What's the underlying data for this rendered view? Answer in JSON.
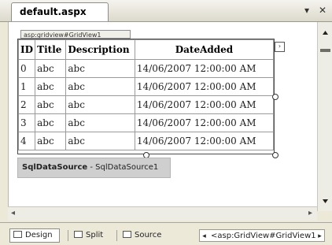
{
  "tab": {
    "title": "default.aspx",
    "dropdown_glyph": "▾",
    "close_glyph": "✕"
  },
  "control_tag": "asp:gridview#GridView1",
  "grid": {
    "columns": [
      "ID",
      "Title",
      "Description",
      "DateAdded"
    ],
    "rows": [
      [
        "0",
        "abc",
        "abc",
        "14/06/2007 12:00:00 AM"
      ],
      [
        "1",
        "abc",
        "abc",
        "14/06/2007 12:00:00 AM"
      ],
      [
        "2",
        "abc",
        "abc",
        "14/06/2007 12:00:00 AM"
      ],
      [
        "3",
        "abc",
        "abc",
        "14/06/2007 12:00:00 AM"
      ],
      [
        "4",
        "abc",
        "abc",
        "14/06/2007 12:00:00 AM"
      ]
    ],
    "smart_tag_glyph": "›"
  },
  "datasource": {
    "name": "SqlDataSource",
    "id": "SqlDataSource1",
    "separator": " - "
  },
  "bottom": {
    "design": "Design",
    "split": "Split",
    "source": "Source",
    "breadcrumb": "<asp:GridView#GridView1"
  }
}
